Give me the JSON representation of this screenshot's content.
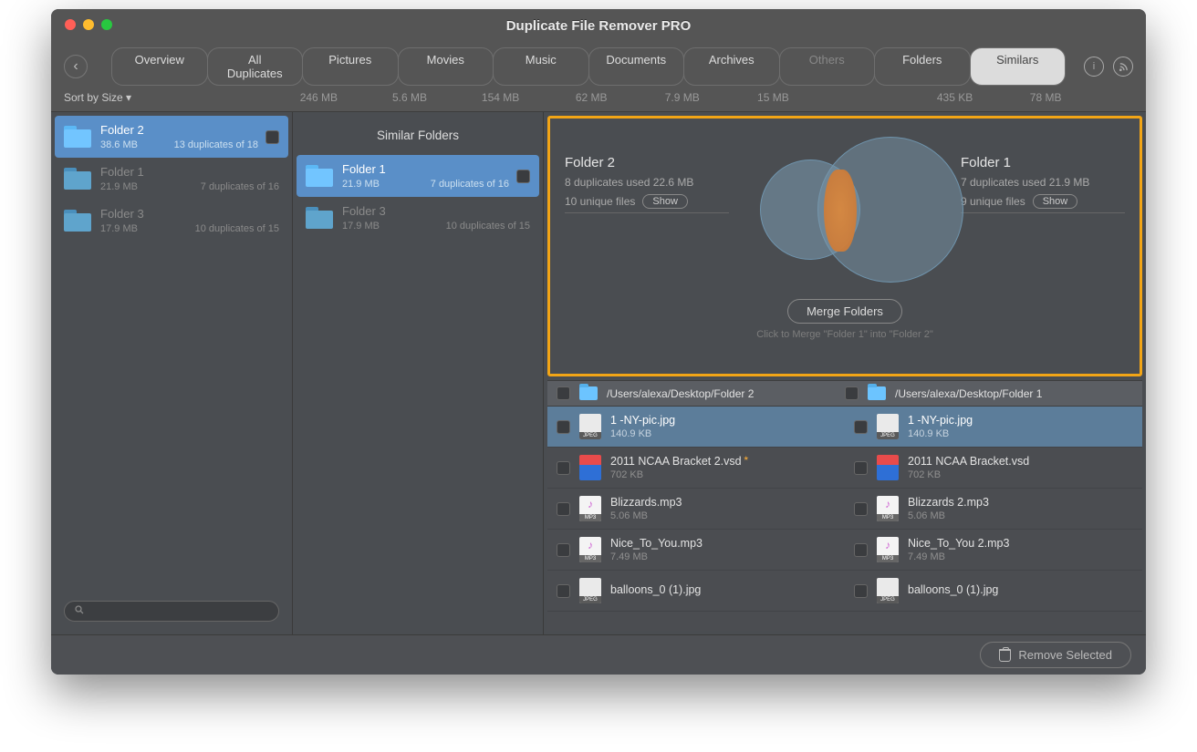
{
  "window": {
    "title": "Duplicate File Remover PRO"
  },
  "toolbar": {
    "tabs": [
      {
        "label": "Overview",
        "size": ""
      },
      {
        "label": "All Duplicates",
        "size": "246 MB"
      },
      {
        "label": "Pictures",
        "size": "5.6 MB"
      },
      {
        "label": "Movies",
        "size": "154 MB"
      },
      {
        "label": "Music",
        "size": "62 MB"
      },
      {
        "label": "Documents",
        "size": "7.9 MB"
      },
      {
        "label": "Archives",
        "size": "15 MB"
      },
      {
        "label": "Others",
        "size": ""
      },
      {
        "label": "Folders",
        "size": "435 KB"
      },
      {
        "label": "Similars",
        "size": "78 MB"
      }
    ],
    "sort_label": "Sort by Size ▾"
  },
  "left_folders": [
    {
      "name": "Folder 2",
      "size": "38.6 MB",
      "dup": "13 duplicates of 18"
    },
    {
      "name": "Folder 1",
      "size": "21.9 MB",
      "dup": "7 duplicates of 16"
    },
    {
      "name": "Folder 3",
      "size": "17.9 MB",
      "dup": "10 duplicates of 15"
    }
  ],
  "mid": {
    "title": "Similar Folders",
    "folders": [
      {
        "name": "Folder 1",
        "size": "21.9 MB",
        "dup": "7 duplicates of 16"
      },
      {
        "name": "Folder 3",
        "size": "17.9 MB",
        "dup": "10 duplicates of 15"
      }
    ]
  },
  "venn": {
    "left": {
      "name": "Folder 2",
      "stat": "8 duplicates used 22.6 MB",
      "unique": "10 unique files",
      "show": "Show"
    },
    "right": {
      "name": "Folder 1",
      "stat": "7 duplicates used 21.9 MB",
      "unique": "9 unique files",
      "show": "Show"
    },
    "merge": "Merge Folders",
    "hint": "Click to Merge \"Folder 1\" into \"Folder 2\""
  },
  "paths": {
    "left": "/Users/alexa/Desktop/Folder 2",
    "right": "/Users/alexa/Desktop/Folder 1"
  },
  "files": [
    {
      "l_name": "1 -NY-pic.jpg",
      "l_size": "140.9 KB",
      "r_name": "1 -NY-pic.jpg",
      "r_size": "140.9 KB",
      "type": "jpeg",
      "badge": "JPEG"
    },
    {
      "l_name": "2011 NCAA Bracket 2.vsd",
      "l_size": "702 KB",
      "r_name": "2011 NCAA Bracket.vsd",
      "r_size": "702 KB",
      "type": "vsd",
      "badge": "",
      "starred": true
    },
    {
      "l_name": "Blizzards.mp3",
      "l_size": "5.06 MB",
      "r_name": "Blizzards 2.mp3",
      "r_size": "5.06 MB",
      "type": "mp3",
      "badge": "MP3"
    },
    {
      "l_name": "Nice_To_You.mp3",
      "l_size": "7.49 MB",
      "r_name": "Nice_To_You 2.mp3",
      "r_size": "7.49 MB",
      "type": "mp3",
      "badge": "MP3"
    },
    {
      "l_name": "balloons_0 (1).jpg",
      "l_size": "",
      "r_name": "balloons_0 (1).jpg",
      "r_size": "",
      "type": "jpeg",
      "badge": "JPEG"
    }
  ],
  "footer": {
    "remove": "Remove Selected"
  }
}
